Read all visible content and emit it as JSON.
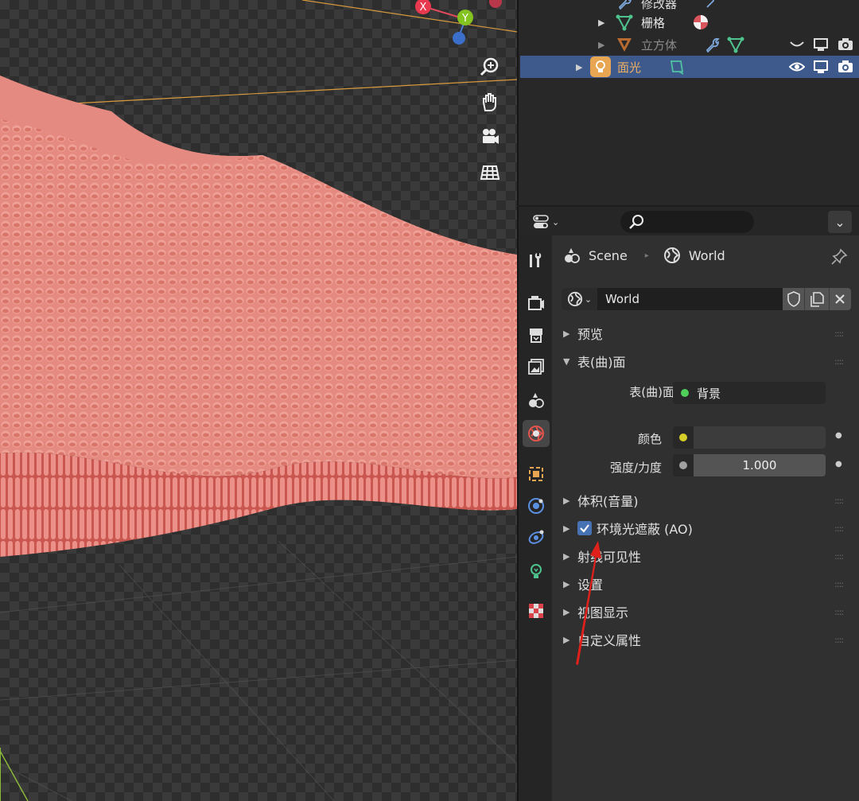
{
  "gizmo": {
    "x_label": "X",
    "y_label": "Y"
  },
  "outliner": {
    "rows": [
      {
        "label": "修改器"
      },
      {
        "label": "栅格"
      },
      {
        "label": "立方体"
      },
      {
        "label": "面光"
      }
    ]
  },
  "properties": {
    "search": {
      "placeholder": ""
    },
    "breadcrumb": {
      "scene": "Scene",
      "world": "World"
    },
    "world_selector": {
      "value": "World"
    },
    "sections": {
      "preview": "预览",
      "surface": "表(曲)面",
      "volume": "体积(音量)",
      "ao": "环境光遮蔽 (AO)",
      "ray_visibility": "射线可见性",
      "settings": "设置",
      "viewport_display": "视图显示",
      "custom_props": "自定义属性"
    },
    "surface_fields": {
      "surface_label": "表(曲)面",
      "surface_value": "背景",
      "color_label": "颜色",
      "strength_label": "强度/力度",
      "strength_value": "1.000"
    },
    "ao_enabled": true
  },
  "colors": {
    "accent": "#4772b3",
    "selected_row": "#3e5a8c",
    "light_orange": "#e8a552",
    "mesh_pink": "#e5847c",
    "annotation_red": "#e0201a"
  }
}
